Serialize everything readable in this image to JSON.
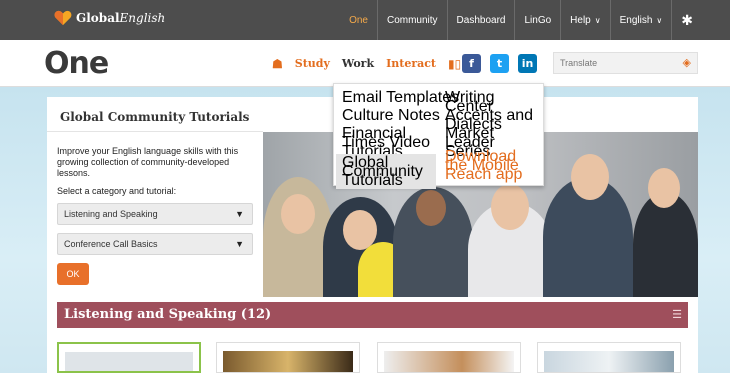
{
  "topbar": {
    "brand_main": "Global",
    "brand_script": "English",
    "nav": [
      "One",
      "Community",
      "Dashboard",
      "LinGo",
      "Help",
      "English"
    ],
    "gear_icon": "gear-icon",
    "active_color": "#f4a94a"
  },
  "header": {
    "logo": "One",
    "nav": [
      "Study",
      "Work",
      "Interact"
    ],
    "active": "Work",
    "social": [
      "f",
      "t",
      "in"
    ],
    "social_colors": [
      "#3b5998",
      "#1da1f2",
      "#0077b5"
    ],
    "translate_placeholder": "Translate",
    "accent": "#e36d1e"
  },
  "dropdown": {
    "left": [
      "Email Templates",
      "Culture Notes",
      "Financial Times Video Tutorials",
      "Global Community Tutorials"
    ],
    "right": [
      "Writing Center",
      "Accents and Dialects",
      "Market Leader Series",
      "Download the Mobile Reach app"
    ],
    "highlighted": "Global Community Tutorials"
  },
  "card": {
    "title": "Global Community Tutorials",
    "intro": "Improve your English language skills with this growing collection of community-developed lessons.",
    "select_prompt": "Select a category and tutorial:",
    "category": "Listening and Speaking",
    "tutorial": "Conference Call Basics",
    "ok": "OK"
  },
  "section": {
    "title": "Listening and Speaking (12)",
    "color": "#9f4f5c"
  }
}
